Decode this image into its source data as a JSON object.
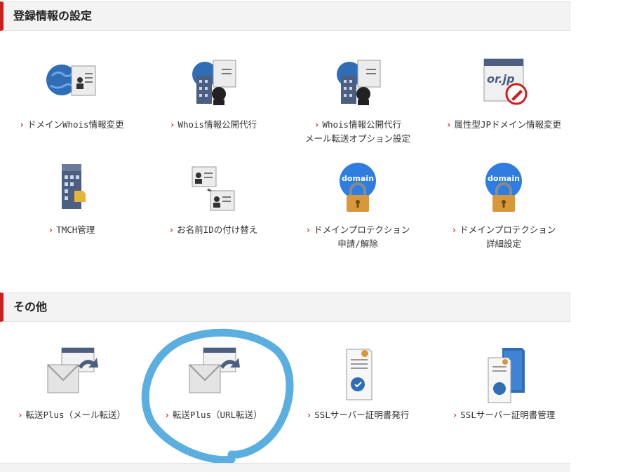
{
  "sections": [
    {
      "title": "登録情報の設定",
      "items": [
        {
          "label": "ドメインWhois情報変更",
          "label2": "",
          "icon": "globe-id-card-icon"
        },
        {
          "label": "Whois情報公開代行",
          "label2": "",
          "icon": "building-id-card-icon"
        },
        {
          "label": "Whois情報公開代行",
          "label2": "メール転送オプション設定",
          "icon": "building-id-card-mail-icon"
        },
        {
          "label": "属性型JPドメイン情報変更",
          "label2": "",
          "icon": "or-jp-edit-icon"
        },
        {
          "label": "TMCH管理",
          "label2": "",
          "icon": "tmch-building-icon"
        },
        {
          "label": "お名前IDの付け替え",
          "label2": "",
          "icon": "id-swap-icon"
        },
        {
          "label": "ドメインプロテクション",
          "label2": "申請/解除",
          "icon": "domain-lock-icon"
        },
        {
          "label": "ドメインプロテクション",
          "label2": "詳細設定",
          "icon": "domain-lock-icon"
        }
      ]
    },
    {
      "title": "その他",
      "items": [
        {
          "label": "転送Plus（メール転送）",
          "label2": "",
          "icon": "mail-forward-icon"
        },
        {
          "label": "転送Plus（URL転送）",
          "label2": "",
          "icon": "url-forward-icon"
        },
        {
          "label": "SSLサーバー証明書発行",
          "label2": "",
          "icon": "ssl-certificate-icon"
        },
        {
          "label": "SSLサーバー証明書管理",
          "label2": "",
          "icon": "ssl-certificate-manage-icon"
        }
      ]
    }
  ],
  "arrow_glyph": "›",
  "colors": {
    "accent": "#cc1f1f",
    "globe": "#2f6db6",
    "lock": "#d8973a",
    "annotation": "#5aaee0",
    "building": "#4d5f80"
  }
}
